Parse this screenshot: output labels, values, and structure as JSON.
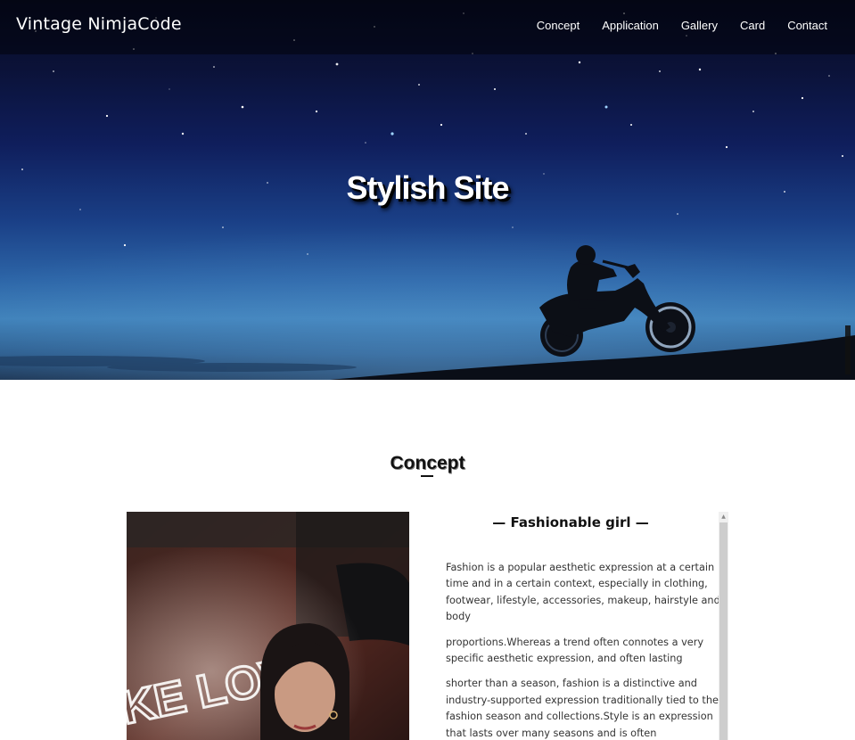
{
  "header": {
    "brand": "Vintage NimjaCode",
    "nav": [
      "Concept",
      "Application",
      "Gallery",
      "Card",
      "Contact"
    ]
  },
  "hero": {
    "title": "Stylish Site"
  },
  "concept": {
    "section_title": "Concept",
    "article": {
      "title": "— Fashionable girl —",
      "paragraphs": [
        "Fashion is a popular aesthetic expression at a certain time and in a certain context, especially in clothing, footwear, lifestyle, accessories, makeup, hairstyle and body",
        "proportions.Whereas a trend often connotes a very specific aesthetic expression, and often lasting",
        "shorter than a season, fashion is a distinctive and industry-supported expression traditionally tied to the fashion season and collections.Style is an expression that lasts over many seasons and is often"
      ]
    },
    "photo": {
      "sign_text": "KE LOVE"
    }
  },
  "colors": {
    "header_bg": "rgba(0,0,0,0.42)",
    "sky_top": "#070b24",
    "sky_horizon": "#3f81b9",
    "text_dark": "#111111"
  }
}
